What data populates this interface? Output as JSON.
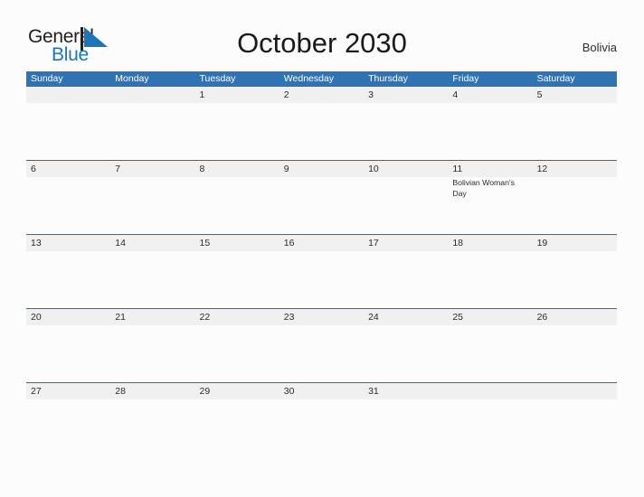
{
  "brand": {
    "word_one": "General",
    "word_two": "Blue",
    "flag_icon": "flag-icon",
    "color_dark": "#231f20",
    "color_blue": "#1b75bb"
  },
  "header": {
    "title": "October 2030",
    "region": "Bolivia"
  },
  "colors": {
    "header_band": "#3073b5",
    "row_divider": "#2c6ca8",
    "date_band": "#f0f0f0",
    "page_background": "#fcfcfd",
    "text": "#2b2b2b"
  },
  "calendar": {
    "month": "October",
    "year": "2030",
    "weekday_headers": [
      "Sunday",
      "Monday",
      "Tuesday",
      "Wednesday",
      "Thursday",
      "Friday",
      "Saturday"
    ],
    "weeks": [
      {
        "days": [
          {
            "num": "",
            "events": ""
          },
          {
            "num": "",
            "events": ""
          },
          {
            "num": "1",
            "events": ""
          },
          {
            "num": "2",
            "events": ""
          },
          {
            "num": "3",
            "events": ""
          },
          {
            "num": "4",
            "events": ""
          },
          {
            "num": "5",
            "events": ""
          }
        ]
      },
      {
        "days": [
          {
            "num": "6",
            "events": ""
          },
          {
            "num": "7",
            "events": ""
          },
          {
            "num": "8",
            "events": ""
          },
          {
            "num": "9",
            "events": ""
          },
          {
            "num": "10",
            "events": ""
          },
          {
            "num": "11",
            "events": "Bolivian Woman's Day"
          },
          {
            "num": "12",
            "events": ""
          }
        ]
      },
      {
        "days": [
          {
            "num": "13",
            "events": ""
          },
          {
            "num": "14",
            "events": ""
          },
          {
            "num": "15",
            "events": ""
          },
          {
            "num": "16",
            "events": ""
          },
          {
            "num": "17",
            "events": ""
          },
          {
            "num": "18",
            "events": ""
          },
          {
            "num": "19",
            "events": ""
          }
        ]
      },
      {
        "days": [
          {
            "num": "20",
            "events": ""
          },
          {
            "num": "21",
            "events": ""
          },
          {
            "num": "22",
            "events": ""
          },
          {
            "num": "23",
            "events": ""
          },
          {
            "num": "24",
            "events": ""
          },
          {
            "num": "25",
            "events": ""
          },
          {
            "num": "26",
            "events": ""
          }
        ]
      },
      {
        "days": [
          {
            "num": "27",
            "events": ""
          },
          {
            "num": "28",
            "events": ""
          },
          {
            "num": "29",
            "events": ""
          },
          {
            "num": "30",
            "events": ""
          },
          {
            "num": "31",
            "events": ""
          },
          {
            "num": "",
            "events": ""
          },
          {
            "num": "",
            "events": ""
          }
        ]
      }
    ]
  }
}
